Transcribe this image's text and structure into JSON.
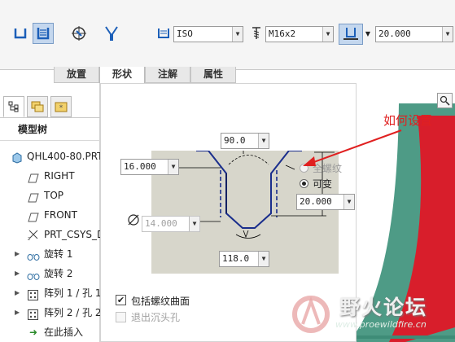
{
  "toolbar": {
    "icons": [
      "hole-simple-icon",
      "hole-standard-icon",
      "sketch-placement-icon",
      "drill-cone-icon"
    ],
    "thread_standard": "ISO",
    "screw_size": "M16x2",
    "depth_value": "20.000"
  },
  "tabs": [
    "放置",
    "形状",
    "注解",
    "属性"
  ],
  "active_tab": "形状",
  "panel": {
    "tab_icons": [
      "tree-view-icon",
      "layers-icon",
      "favorites-icon"
    ],
    "title": "模型树",
    "items": [
      {
        "label": "QHL400-80.PRT",
        "icon": "part-icon"
      },
      {
        "label": "RIGHT",
        "icon": "datum-plane-icon"
      },
      {
        "label": "TOP",
        "icon": "datum-plane-icon"
      },
      {
        "label": "FRONT",
        "icon": "datum-plane-icon"
      },
      {
        "label": "PRT_CSYS_D",
        "icon": "csys-icon"
      },
      {
        "label": "旋转 1",
        "icon": "revolve-icon"
      },
      {
        "label": "旋转 2",
        "icon": "revolve-icon"
      },
      {
        "label": "阵列 1 / 孔 1",
        "icon": "pattern-icon"
      },
      {
        "label": "阵列 2 / 孔 2",
        "icon": "pattern-icon"
      },
      {
        "label": "在此插入",
        "icon": "insert-arrow-icon"
      }
    ]
  },
  "shape": {
    "angle": "90.0",
    "countersink_dia": "16.000",
    "diameter": "14.000",
    "tip_angle": "118.0",
    "thread_depth": "20.000",
    "full_thread_label": "全螺纹",
    "variable_label": "可变",
    "include_thread_surface": "包括螺纹曲面",
    "exit_countersink": "退出沉头孔"
  },
  "annotation": "如何设置",
  "watermark": {
    "title": "野火论坛",
    "url": "www.proewildfire.cn"
  },
  "colors": {
    "annotation_red": "#e02020",
    "hole_blue": "#1a2e8c",
    "drawing_bg": "#d7d6cb"
  }
}
